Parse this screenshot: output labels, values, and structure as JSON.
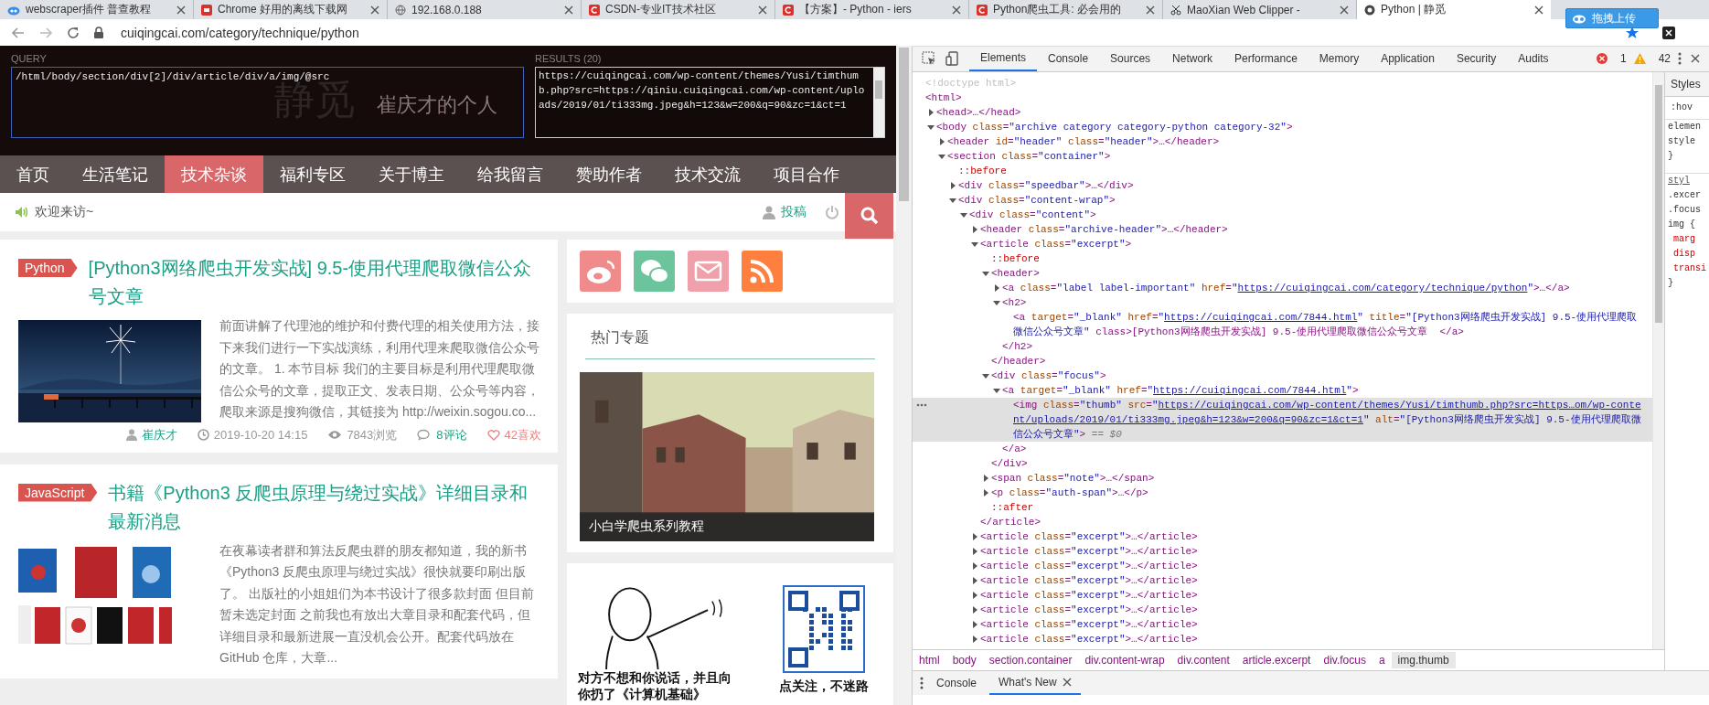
{
  "browser": {
    "tabs": [
      {
        "title": "webscraper插件 普查教程",
        "kind": "cloud",
        "selected": false
      },
      {
        "title": "Chrome 好用的离线下载网",
        "kind": "badge",
        "selected": false
      },
      {
        "title": "192.168.0.188",
        "kind": "globe",
        "selected": false
      },
      {
        "title": "CSDN-专业IT技术社区",
        "kind": "c-logo",
        "selected": false
      },
      {
        "title": "【方案】- Python - iers",
        "kind": "c-logo",
        "selected": false
      },
      {
        "title": "Python爬虫工具: 必会用的",
        "kind": "c-logo",
        "selected": false
      },
      {
        "title": "MaoXian Web Clipper - ",
        "kind": "scissors",
        "selected": false
      },
      {
        "title": "Python | 静觅",
        "kind": "circle",
        "selected": true
      }
    ],
    "address": "cuiqingcai.com/category/technique/python",
    "upload_button": "拖拽上传"
  },
  "site": {
    "logo": "静觅",
    "tagline": "崔庆才的个人",
    "xpath_helper": {
      "query_label": "QUERY",
      "query": "/html/body/section/div[2]/div/article/div/a/img/@src",
      "results_label": "RESULTS (20)",
      "results": "https://cuiqingcai.com/wp-content/themes/Yusi/timthumb.php?src=https://qiniu.cuiqingcai.com/wp-content/uploads/2019/01/ti333mg.jpeg&h=123&w=200&q=90&zc=1&ct=1"
    },
    "nav": [
      {
        "label": "首页",
        "selected": false
      },
      {
        "label": "生活笔记",
        "selected": false
      },
      {
        "label": "技术杂谈",
        "selected": true
      },
      {
        "label": "福利专区",
        "selected": false
      },
      {
        "label": "关于博主",
        "selected": false
      },
      {
        "label": "给我留言",
        "selected": false
      },
      {
        "label": "赞助作者",
        "selected": false
      },
      {
        "label": "技术交流",
        "selected": false
      },
      {
        "label": "项目合作",
        "selected": false
      }
    ],
    "welcome": "欢迎来访~",
    "submit_link": "投稿",
    "articles": [
      {
        "category": "Python",
        "title": "[Python3网络爬虫开发实战] 9.5-使用代理爬取微信公众号文章",
        "excerpt": "前面讲解了代理池的维护和付费代理的相关使用方法，接下来我们进行一下实战演练，利用代理来爬取微信公众号的文章。 1. 本节目标 我们的主要目标是利用代理爬取微信公众号的文章，提取正文、发表日期、公众号等内容，爬取来源是搜狗微信，其链接为 http://weixin.sogou.co...",
        "author": "崔庆才",
        "date": "2019-10-20 14:15",
        "views": "7843浏览",
        "comments": "8评论",
        "likes": "42喜欢"
      },
      {
        "category": "JavaScript",
        "title": "书籍《Python3 反爬虫原理与绕过实战》详细目录和最新消息",
        "excerpt": "在夜幕读者群和算法反爬虫群的朋友都知道，我的新书《Python3 反爬虫原理与绕过实战》很快就要印刷出版了。 出版社的小姐姐们为本书设计了很多款封面 但目前暂未选定封面 之前我也有放出大章目录和配套代码，但详细目录和最新进展一直没机会公开。配套代码放在 GitHub 仓库，大章..."
      }
    ],
    "social": [
      {
        "kind": "weibo"
      },
      {
        "kind": "wechat"
      },
      {
        "kind": "mail"
      },
      {
        "kind": "rss"
      }
    ],
    "hot_topics": {
      "title": "热门专题",
      "caption": "小白学爬虫系列教程"
    },
    "promo": {
      "meme_caption": "对方不想和你说话，并且向你扔了《计算机基础》",
      "qr_caption": "点关注，不迷路"
    }
  },
  "devtools": {
    "tabs": [
      {
        "label": "Elements",
        "selected": true
      },
      {
        "label": "Console",
        "selected": false
      },
      {
        "label": "Sources",
        "selected": false
      },
      {
        "label": "Network",
        "selected": false
      },
      {
        "label": "Performance",
        "selected": false
      },
      {
        "label": "Memory",
        "selected": false
      },
      {
        "label": "Application",
        "selected": false
      },
      {
        "label": "Security",
        "selected": false
      },
      {
        "label": "Audits",
        "selected": false
      }
    ],
    "errors": "1",
    "warnings": "42",
    "tree": [
      {
        "kind": "doctype",
        "open": "<!doctype html>",
        "selected": false
      },
      {
        "kind": "element",
        "open": "<html>",
        "selected": false,
        "children": [
          {
            "kind": "element",
            "open": "<head>",
            "close": "…</head>",
            "expanded": false,
            "selected": false
          },
          {
            "kind": "element",
            "open": "<body class=\"archive category category-python category-32\">",
            "expanded": true,
            "selected": false,
            "children": [
              {
                "kind": "element",
                "open": "<header id=\"header\" class=\"header\">",
                "close": "…</header>",
                "expanded": false,
                "selected": false
              },
              {
                "kind": "element",
                "open": "<section class=\"container\">",
                "expanded": true,
                "selected": false,
                "children": [
                  {
                    "kind": "pseudo",
                    "open": "::before",
                    "selected": false
                  },
                  {
                    "kind": "element",
                    "open": "<div class=\"speedbar\">",
                    "close": "…</div>",
                    "expanded": false,
                    "selected": false
                  },
                  {
                    "kind": "element",
                    "open": "<div class=\"content-wrap\">",
                    "expanded": true,
                    "selected": false,
                    "children": [
                      {
                        "kind": "element",
                        "open": "<div class=\"content\">",
                        "expanded": true,
                        "selected": false,
                        "children": [
                          {
                            "kind": "element",
                            "open": "<header class=\"archive-header\">",
                            "close": "…</header>",
                            "expanded": false,
                            "selected": false
                          },
                          {
                            "kind": "element",
                            "open": "<article class=\"excerpt\">",
                            "close": "</article>",
                            "expanded": true,
                            "selected": false,
                            "children": [
                              {
                                "kind": "pseudo",
                                "open": "::before",
                                "selected": false
                              },
                              {
                                "kind": "element",
                                "open": "<header>",
                                "close": "</header>",
                                "expanded": true,
                                "selected": false,
                                "children": [
                                  {
                                    "kind": "element",
                                    "open": "<a class=\"label label-important\" href=\"https://cuiqingcai.com/category/technique/python\">",
                                    "close": "…</a>",
                                    "expanded": false,
                                    "link": true,
                                    "selected": false
                                  },
                                  {
                                    "kind": "element",
                                    "open": "<h2>",
                                    "close": "</h2>",
                                    "expanded": true,
                                    "selected": false,
                                    "children": [
                                      {
                                        "kind": "element",
                                        "open": "<a target=\"_blank\" href=\"https://cuiqingcai.com/7844.html\" title=\"[Python3网络爬虫开发实战] 9.5-使用代理爬取微信公众号文章\" class>[Python3网络爬虫开发实战] 9.5-使用代理爬取微信公众号文章  </a>",
                                        "link": true,
                                        "selected": false
                                      }
                                    ]
                                  }
                                ]
                              },
                              {
                                "kind": "element",
                                "open": "<div class=\"focus\">",
                                "close": "</div>",
                                "expanded": true,
                                "selected": false,
                                "children": [
                                  {
                                    "kind": "element",
                                    "open": "<a target=\"_blank\" href=\"https://cuiqingcai.com/7844.html\">",
                                    "close": "</a>",
                                    "expanded": true,
                                    "link": true,
                                    "selected": false,
                                    "children": [
                                      {
                                        "kind": "element",
                                        "open": "<img class=\"thumb\" src=\"https://cuiqingcai.com/wp-content/themes/Yusi/timthumb.php?src=https…om/wp-content/uploads/2019/01/ti333mg.jpeg&h=123&w=200&q=90&zc=1&ct=1\" alt=\"[Python3网络爬虫开发实战] 9.5-使用代理爬取微信公众号文章\">",
                                        "suffix": "== $0",
                                        "link": true,
                                        "selected": true
                                      }
                                    ]
                                  }
                                ]
                              },
                              {
                                "kind": "element",
                                "open": "<span class=\"note\">",
                                "close": "…</span>",
                                "expanded": false,
                                "selected": false
                              },
                              {
                                "kind": "element",
                                "open": "<p class=\"auth-span\">",
                                "close": "…</p>",
                                "expanded": false,
                                "selected": false
                              },
                              {
                                "kind": "pseudo",
                                "open": "::after",
                                "selected": false
                              }
                            ]
                          },
                          {
                            "kind": "element",
                            "open": "<article class=\"excerpt\">",
                            "close": "…</article>",
                            "expanded": false,
                            "selected": false
                          },
                          {
                            "kind": "element",
                            "open": "<article class=\"excerpt\">",
                            "close": "…</article>",
                            "expanded": false,
                            "selected": false
                          },
                          {
                            "kind": "element",
                            "open": "<article class=\"excerpt\">",
                            "close": "…</article>",
                            "expanded": false,
                            "selected": false
                          },
                          {
                            "kind": "element",
                            "open": "<article class=\"excerpt\">",
                            "close": "…</article>",
                            "expanded": false,
                            "selected": false
                          },
                          {
                            "kind": "element",
                            "open": "<article class=\"excerpt\">",
                            "close": "…</article>",
                            "expanded": false,
                            "selected": false
                          },
                          {
                            "kind": "element",
                            "open": "<article class=\"excerpt\">",
                            "close": "…</article>",
                            "expanded": false,
                            "selected": false
                          },
                          {
                            "kind": "element",
                            "open": "<article class=\"excerpt\">",
                            "close": "…</article>",
                            "expanded": false,
                            "selected": false
                          },
                          {
                            "kind": "element",
                            "open": "<article class=\"excerpt\">",
                            "close": "…</article>",
                            "expanded": false,
                            "selected": false
                          }
                        ]
                      }
                    ]
                  }
                ]
              }
            ]
          }
        ]
      }
    ],
    "breadcrumbs": [
      {
        "label": "html",
        "selected": false
      },
      {
        "label": "body",
        "selected": false
      },
      {
        "label": "section.container",
        "selected": false
      },
      {
        "label": "div.content-wrap",
        "selected": false
      },
      {
        "label": "div.content",
        "selected": false
      },
      {
        "label": "article.excerpt",
        "selected": false
      },
      {
        "label": "div.focus",
        "selected": false
      },
      {
        "label": "a",
        "selected": false
      },
      {
        "label": "img.thumb",
        "selected": true
      }
    ],
    "drawer_tabs": [
      {
        "label": "Console",
        "selected": false,
        "closable": false
      },
      {
        "label": "What's New",
        "selected": true,
        "closable": true
      }
    ],
    "styles": {
      "tab": "Styles",
      "filter": ":hov",
      "lines": [
        {
          "kind": "plain",
          "text": "elemen"
        },
        {
          "kind": "plain",
          "text": "style"
        },
        {
          "kind": "plain",
          "text": "}"
        },
        {
          "kind": "link",
          "text": "styl"
        },
        {
          "kind": "plain",
          "text": ".excer"
        },
        {
          "kind": "plain",
          "text": ".focus"
        },
        {
          "kind": "plain",
          "text": "img {"
        },
        {
          "kind": "prop",
          "text": "marg"
        },
        {
          "kind": "prop",
          "text": "disp"
        },
        {
          "kind": "prop",
          "text": "transi"
        },
        {
          "kind": "plain",
          "text": "}"
        }
      ]
    }
  }
}
